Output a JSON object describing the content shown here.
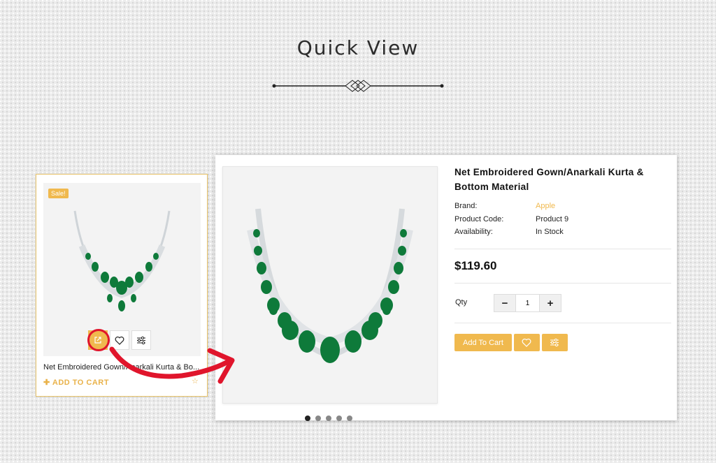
{
  "page": {
    "title": "Quick View"
  },
  "card": {
    "badge": "Sale!",
    "name": "Net Embroidered Gown/Anarkali Kurta & Bo...",
    "add_to_cart": "ADD TO CART",
    "add_icon": "plus-icon",
    "actions": [
      "quick-view-icon",
      "heart-icon",
      "compare-icon"
    ],
    "rating_icon": "star-icon"
  },
  "quick_view": {
    "title": "Net Embroidered Gown/Anarkali Kurta & Bottom Material",
    "brand_label": "Brand:",
    "brand_value": "Apple",
    "code_label": "Product Code:",
    "code_value": "Product 9",
    "availability_label": "Availability:",
    "availability_value": "In Stock",
    "price": "$119.60",
    "qty_label": "Qty",
    "qty_value": "1",
    "qty_minus": "−",
    "qty_plus": "+",
    "add_to_cart": "Add To Cart",
    "wishlist_icon": "heart-icon",
    "compare_icon": "compare-icon",
    "image_dots": 5,
    "active_dot": 1
  },
  "colors": {
    "accent": "#f0b94e",
    "highlight": "#e0152c",
    "emerald": "#0e7a3a"
  }
}
